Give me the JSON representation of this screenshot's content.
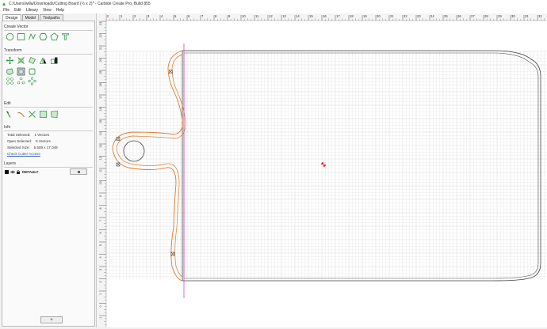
{
  "window": {
    "title": "C:/Users/willa/Downloads/Cutting Board (½ x 2)* - Carbide Create Pro, Build 855"
  },
  "menu": [
    "File",
    "Edit",
    "Library",
    "View",
    "Help"
  ],
  "tabs": [
    {
      "label": "Design",
      "active": true
    },
    {
      "label": "Model",
      "active": false
    },
    {
      "label": "Toolpaths",
      "active": false
    }
  ],
  "sections": {
    "create_vector": "Create Vector",
    "transform": "Transform",
    "edit": "Edit",
    "info": "Info",
    "layers": "Layers"
  },
  "create_vector_icons": [
    "circle-icon",
    "rectangle-icon",
    "curve-icon",
    "polygon-icon",
    "pentagon-icon",
    "text-icon"
  ],
  "transform_icons_row1": [
    "move-icon",
    "scale-icon",
    "rotate-icon",
    "mirror-icon",
    "align-icon"
  ],
  "transform_icons_row2": [
    "offset-icon",
    "fillet-icon",
    "boolean-icon"
  ],
  "edit_icons": [
    "node-edit-icon",
    "trim-icon",
    "cut-icon",
    "join-icon",
    "close-vector-icon"
  ],
  "info": {
    "total_selected_label": "Total Selected:",
    "total_selected_value": "1 Vectors",
    "open_selected_label": "Open Selected:",
    "open_selected_value": "0 Vectors",
    "selected_size_label": "Selected Size:",
    "selected_size_value": "5.509 x 17.049",
    "check_cutter_access": "Check Cutter Access"
  },
  "layers": [
    {
      "name": "DEFAULT",
      "color": "#000000"
    }
  ],
  "add_layer_label": "+",
  "ruler": {
    "top_ticks": [
      "0",
      "1",
      "2",
      "3",
      "4",
      "5",
      "6",
      "7",
      "8",
      "9",
      "10",
      "11",
      "12",
      "13",
      "14",
      "15",
      "16",
      "17",
      "18",
      "19",
      "20",
      "21",
      "22",
      "23",
      "24",
      "25",
      "26",
      "27",
      "28",
      "29",
      "30",
      "31",
      "32",
      "33",
      "34",
      "35",
      "36",
      "37"
    ],
    "left_ticks": [
      "23",
      "22",
      "21",
      "20",
      "19",
      "18",
      "17",
      "16",
      "15",
      "14",
      "13",
      "12",
      "11",
      "10",
      "9",
      "8",
      "7",
      "6",
      "5",
      "4",
      "3",
      "2",
      "1",
      "0",
      "-1",
      "-2"
    ]
  },
  "colors": {
    "selection": "#e07a2a",
    "guide": "#e040c0",
    "origin": "#e02020",
    "grid_minor": "#e6e6e6",
    "grid_major": "#cfcfcf"
  }
}
